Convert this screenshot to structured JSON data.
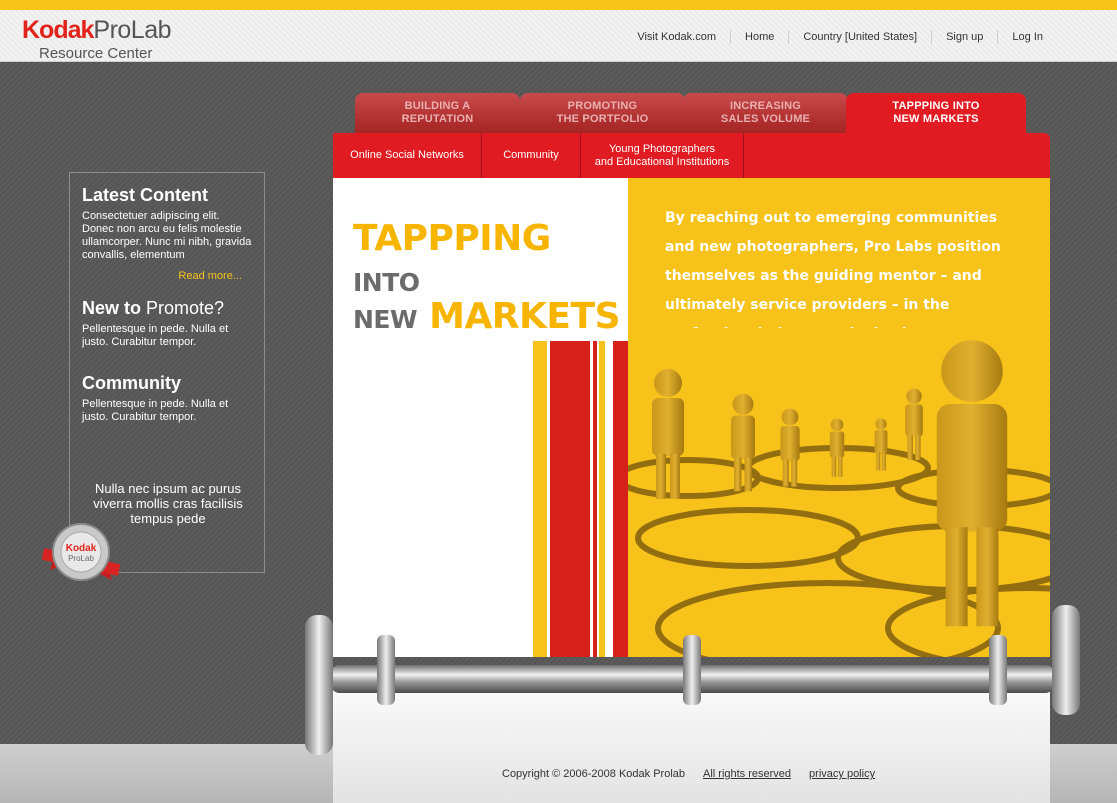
{
  "header": {
    "logo_brand": "Kodak",
    "logo_product": "ProLab",
    "logo_subtitle": "Resource Center",
    "nav": [
      "Visit Kodak.com",
      "Home",
      "Country [United States]",
      "Sign up",
      "Log In"
    ]
  },
  "tabs": [
    {
      "line1": "BUILDING A",
      "line2": "REPUTATION"
    },
    {
      "line1": "PROMOTING",
      "line2": "THE PORTFOLIO"
    },
    {
      "line1": "INCREASING",
      "line2": "SALES VOLUME"
    },
    {
      "line1": "TAPPPING INTO",
      "line2": "NEW MARKETS"
    }
  ],
  "subnav": [
    {
      "line1": "Online Social Networks",
      "line2": ""
    },
    {
      "line1": "Community",
      "line2": ""
    },
    {
      "line1": "Young Photographers",
      "line2": "and Educational Institutions"
    }
  ],
  "sidebar": {
    "latest_title": "Latest Content",
    "latest_text": "Consectetuer adipiscing elit. Donec non arcu eu felis molestie ullamcorper. Nunc mi nibh, gravida convallis, elementum",
    "read_more": "Read more...",
    "promote_title_bold": "New to",
    "promote_title_light": "Promote?",
    "promote_text": "Pellentesque in pede. Nulla et justo. Curabitur tempor.",
    "community_title": "Community",
    "community_text": "Pellentesque in pede. Nulla et justo. Curabitur tempor.",
    "quote": "Nulla nec ipsum ac purus viverra mollis cras facilisis tempus pede",
    "seal_brand": "Kodak",
    "seal_product": "ProLab"
  },
  "main": {
    "headline_big1": "TAPPPING",
    "headline_small1": "INTO",
    "headline_small2": "NEW",
    "headline_big2": "MARKETS",
    "intro": "By reaching out to emerging communities and new photographers, Pro Labs position themselves as the guiding mentor – and ultimately service providers – in the professional photography business."
  },
  "footer": {
    "copyright": "Copyright © 2006-2008 Kodak Prolab",
    "links": [
      "All rights reserved",
      "privacy policy"
    ]
  },
  "colors": {
    "accent_yellow": "#f7c21a",
    "accent_red": "#e11b22"
  }
}
